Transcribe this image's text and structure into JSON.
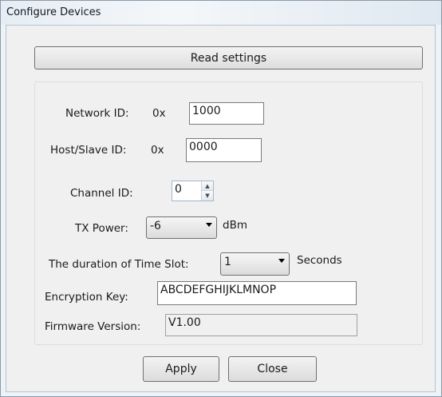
{
  "window": {
    "title": "Configure Devices"
  },
  "read_settings": {
    "label": "Read settings"
  },
  "network_id": {
    "label": "Network ID:",
    "prefix": "0x",
    "value": "1000"
  },
  "host_slave_id": {
    "label": "Host/Slave ID:",
    "prefix": "0x",
    "value": "0000"
  },
  "channel_id": {
    "label": "Channel ID:",
    "value": "0"
  },
  "tx_power": {
    "label": "TX Power:",
    "value": "-6",
    "unit": "dBm"
  },
  "time_slot": {
    "label": "The duration of Time Slot:",
    "value": "1",
    "unit": "Seconds"
  },
  "encryption_key": {
    "label": "Encryption Key:",
    "value": "ABCDEFGHIJKLMNOP"
  },
  "firmware_version": {
    "label": "Firmware Version:",
    "value": "V1.00"
  },
  "buttons": {
    "apply": "Apply",
    "close": "Close"
  }
}
